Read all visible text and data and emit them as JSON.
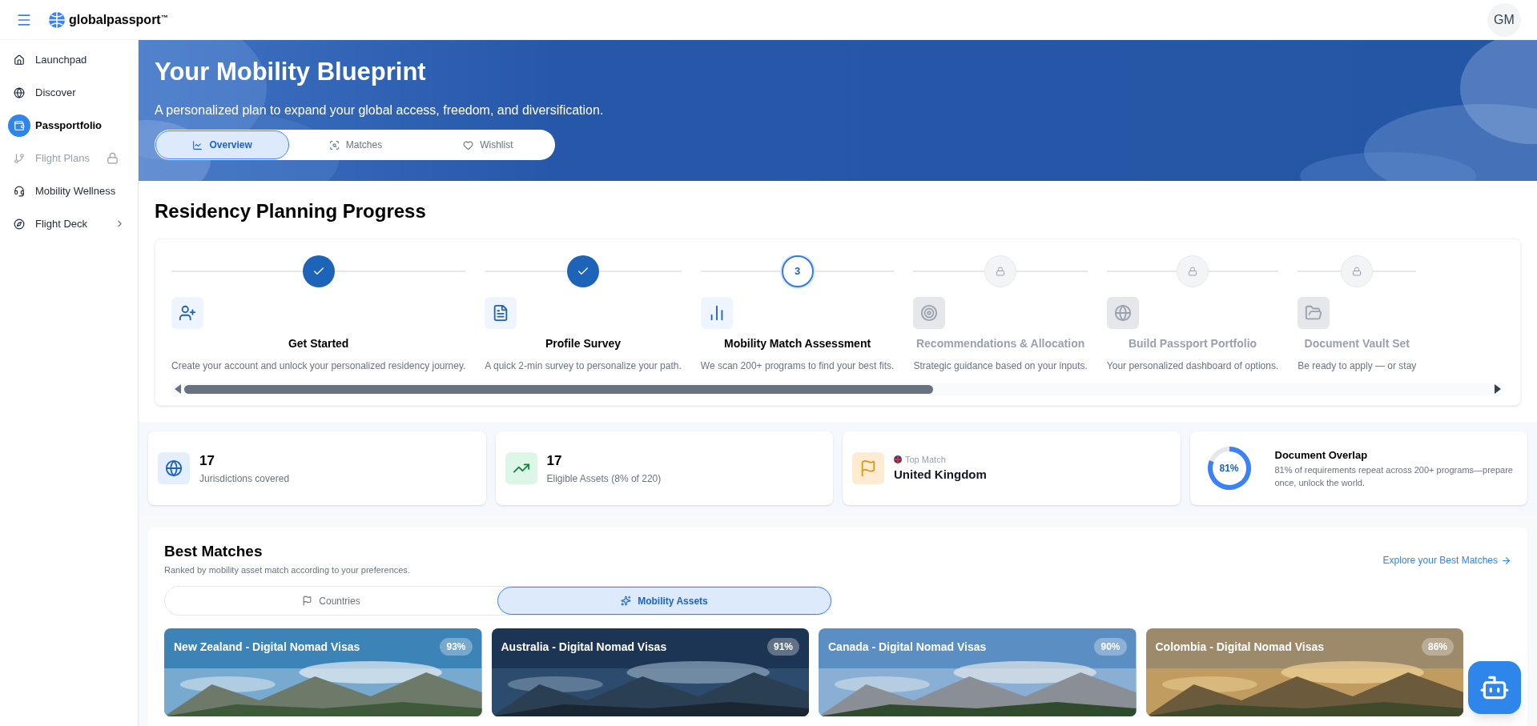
{
  "header": {
    "logo": "globalpassport",
    "trademark": "™",
    "avatar": "GM"
  },
  "sidebar": {
    "items": [
      {
        "label": "Launchpad",
        "kind": "link",
        "selected": false
      },
      {
        "label": "Discover",
        "kind": "link",
        "selected": false
      },
      {
        "label": "Passportfolio",
        "kind": "link",
        "selected": true
      },
      {
        "label": "Flight Plans",
        "kind": "locked",
        "selected": false
      },
      {
        "label": "Mobility Wellness",
        "kind": "link",
        "selected": false
      },
      {
        "label": "Flight Deck",
        "kind": "submenu",
        "selected": false
      }
    ]
  },
  "hero": {
    "title": "Your Mobility Blueprint",
    "subtitle": "A personalized plan to expand your global access, freedom, and diversification.",
    "tabs": [
      {
        "label": "Overview",
        "selected": true
      },
      {
        "label": "Matches",
        "selected": false
      },
      {
        "label": "Wishlist",
        "selected": false
      }
    ]
  },
  "progress": {
    "title": "Residency Planning Progress",
    "steps": [
      {
        "done": true,
        "locked": false,
        "title": "Get Started",
        "description": "Create your account and unlock your personalized residency journey."
      },
      {
        "done": true,
        "locked": false,
        "title": "Profile Survey",
        "description": "A quick 2-min survey to personalize your path."
      },
      {
        "done": false,
        "locked": false,
        "number": "3",
        "title": "Mobility Match Assessment",
        "description": "We scan 200+ programs to find your best fits."
      },
      {
        "done": false,
        "locked": true,
        "title": "Recommendations & Allocation",
        "description": "Strategic guidance based on your inputs."
      },
      {
        "done": false,
        "locked": true,
        "title": "Build Passport Portfolio",
        "description": "Your personalized dashboard of options."
      },
      {
        "done": false,
        "locked": true,
        "title": "Document Vault Set",
        "description": "Be ready to apply — or stay"
      }
    ]
  },
  "stats": [
    {
      "kind": "count",
      "value": "17",
      "label": "Jurisdictions covered",
      "color": "#e3effc"
    },
    {
      "kind": "count",
      "value": "17",
      "label": "Eligible Assets (8% of 220)",
      "color": "#dcf7e8"
    },
    {
      "kind": "match",
      "caption": "Top Match",
      "value": "United Kingdom",
      "color": "#fdecd2"
    },
    {
      "kind": "ring",
      "level": 0.81,
      "reading": "81%",
      "title": "Document Overlap",
      "description": "81% of requirements repeat across 200+ programs—prepare once, unlock the world."
    }
  ],
  "best_matches": {
    "title": "Best Matches",
    "subtitle": "Ranked by mobility asset match according to your preferences.",
    "link": "Explore your Best Matches",
    "tabs": [
      {
        "label": "Countries",
        "selected": false
      },
      {
        "label": "Mobility Assets",
        "selected": true
      }
    ],
    "cards": [
      {
        "title": "New Zealand - Digital Nomad Visas",
        "score": "93%"
      },
      {
        "title": "Australia - Digital Nomad Visas",
        "score": "91%"
      },
      {
        "title": "Canada - Digital Nomad Visas",
        "score": "90%"
      },
      {
        "title": "Colombia - Digital Nomad Visas",
        "score": "86%"
      }
    ]
  }
}
